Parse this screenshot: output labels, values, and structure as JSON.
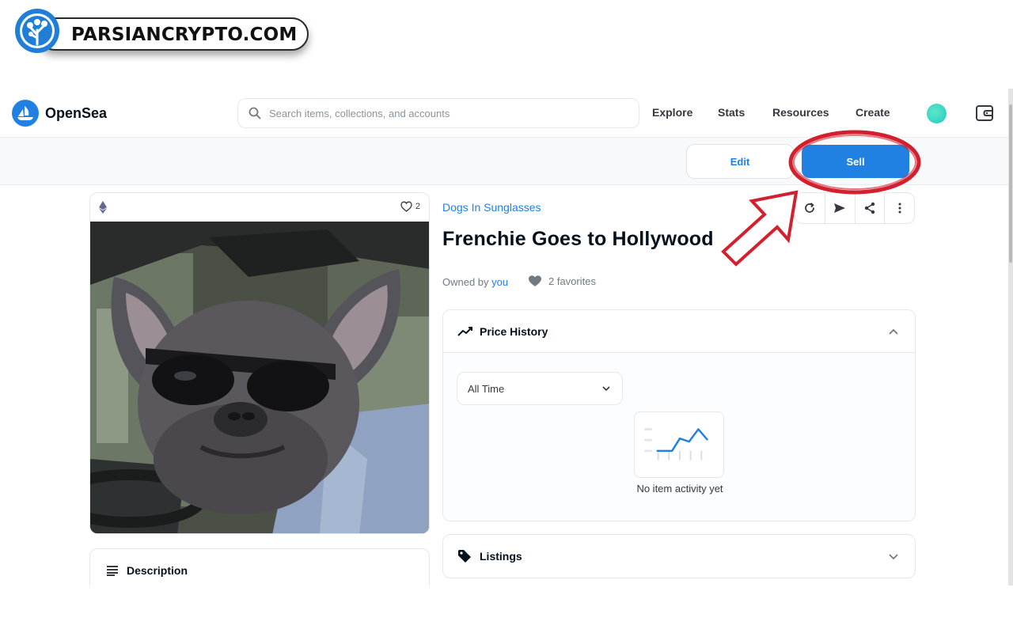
{
  "watermark": {
    "text": "PARSIANCRYPTO.COM"
  },
  "navbar": {
    "brand": "OpenSea",
    "search_placeholder": "Search items, collections, and accounts",
    "links": [
      "Explore",
      "Stats",
      "Resources",
      "Create"
    ]
  },
  "actions": {
    "edit_label": "Edit",
    "sell_label": "Sell"
  },
  "item": {
    "favorites_count": "2",
    "collection": "Dogs In Sunglasses",
    "title": "Frenchie Goes to Hollywood",
    "owned_by_label": "Owned by",
    "owner": "you",
    "favorites_label": "2 favorites"
  },
  "price_history": {
    "title": "Price History",
    "time_filter": "All Time",
    "empty_message": "No item activity yet"
  },
  "listings": {
    "title": "Listings"
  },
  "description": {
    "title": "Description"
  },
  "colors": {
    "accent": "#2081e2",
    "annotation": "#d3202f",
    "avatar": "#2fd3c4"
  },
  "icons": [
    "search-icon",
    "opensea-logo-icon",
    "wallet-icon",
    "ethereum-icon",
    "heart-icon",
    "refresh-icon",
    "send-icon",
    "share-icon",
    "more-icon",
    "trend-icon",
    "chevron-up-icon",
    "chevron-down-icon",
    "tag-icon",
    "description-icon",
    "arrow-annotation"
  ]
}
